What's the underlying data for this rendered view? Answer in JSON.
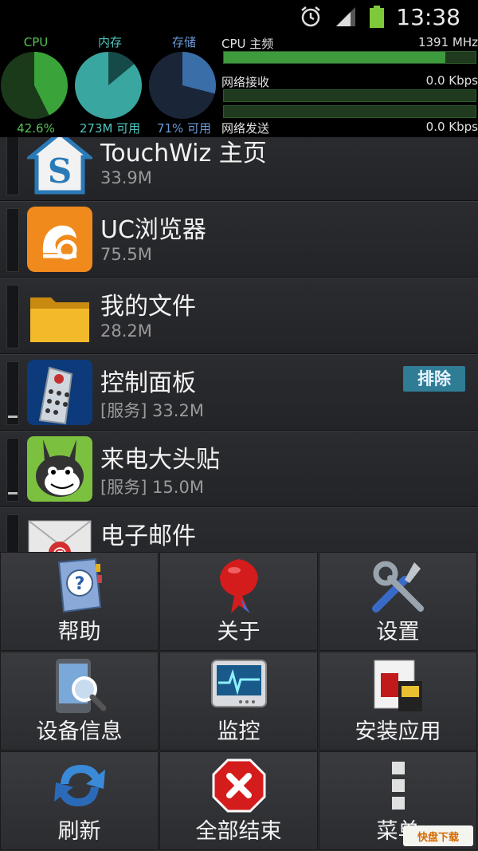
{
  "statusbar": {
    "time": "13:38"
  },
  "monitor": {
    "cpu": {
      "label": "CPU",
      "value": "42.6%",
      "fraction": 0.426,
      "color": "#3aa43a"
    },
    "ram": {
      "label": "内存",
      "value": "273M 可用",
      "fraction_used": 0.14,
      "color": "#3aa6a0"
    },
    "storage": {
      "label": "存储",
      "value": "71% 可用",
      "fraction_used": 0.29,
      "color": "#3a6ea8"
    },
    "cpu_freq": {
      "label": "CPU 主频",
      "value": "1391 MHz",
      "fill": 0.88
    },
    "net_rx": {
      "label": "网络接收",
      "value": "0.0 Kbps",
      "fill": 0.0
    },
    "net_tx": {
      "label": "网络发送",
      "value": "0.0 Kbps",
      "fill": 0.0
    }
  },
  "apps": [
    {
      "name": "TouchWiz 主页",
      "size": "33.9M"
    },
    {
      "name": "UC浏览器",
      "size": "75.5M"
    },
    {
      "name": "我的文件",
      "size": "28.2M"
    },
    {
      "name": "控制面板",
      "size": "[服务] 33.2M",
      "action": "排除"
    },
    {
      "name": "来电大头贴",
      "size": "[服务] 15.0M"
    },
    {
      "name": "电子邮件",
      "size": ""
    }
  ],
  "menu": {
    "help": "帮助",
    "about": "关于",
    "settings": "设置",
    "device_info": "设备信息",
    "monitor": "监控",
    "install_apps": "安装应用",
    "refresh": "刷新",
    "kill_all": "全部结束",
    "more": "菜单"
  },
  "watermark": "快盘下载"
}
